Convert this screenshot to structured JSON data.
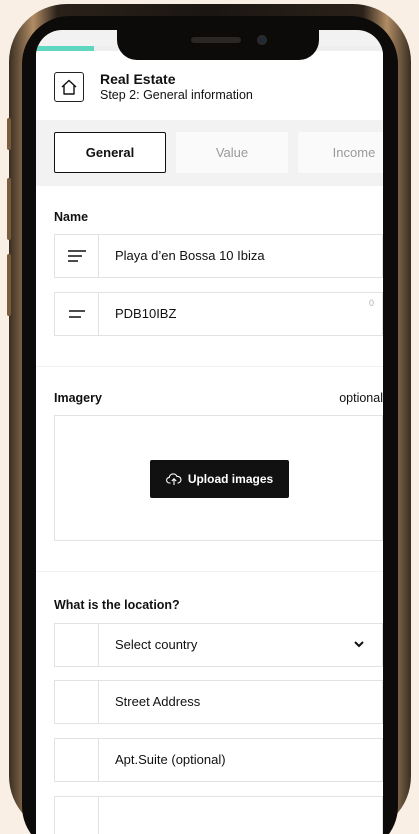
{
  "header": {
    "title": "Real Estate",
    "subtitle": "Step 2: General information"
  },
  "tabs": [
    {
      "label": "General",
      "active": true
    },
    {
      "label": "Value",
      "active": false
    },
    {
      "label": "Income",
      "active": false
    }
  ],
  "name_section": {
    "label": "Name",
    "name_field": {
      "value": "Playa d’en Bossa 10 Ibiza",
      "icon": "text-lines-icon"
    },
    "code_field": {
      "value": "PDB10IBZ",
      "counter": "0",
      "icon": "short-text-icon"
    }
  },
  "imagery_section": {
    "label": "Imagery",
    "optional_label": "optional",
    "upload_label": "Upload images"
  },
  "location_section": {
    "label": "What is the location?",
    "country_select": "Select country",
    "street_placeholder": "Street Address",
    "apt_placeholder": "Apt.Suite (optional)"
  },
  "colors": {
    "accent": "#5fd7c0",
    "dark": "#111111"
  }
}
